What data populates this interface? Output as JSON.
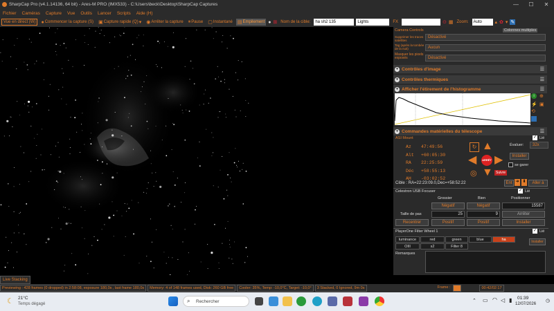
{
  "titlebar": {
    "title": "SharpCap Pro (v4.1.14136, 64 bit) - Ares-M PRO (IMX533) - C:\\Users\\beck\\Desktop\\SharpCap Captures",
    "min": "—",
    "max": "☐",
    "close": "✕"
  },
  "menu": [
    "Fichier",
    "Caméras",
    "Capture",
    "Vue",
    "Outils",
    "Lancer",
    "Scripts",
    "Aide (H)"
  ],
  "toolbar": {
    "live": "Vue en direct (W)",
    "start_capture": "Commencer la capture (S)",
    "quick_capture": "Capture rapide (Q)",
    "stop_capture": "Arrêter la capture",
    "pause": "Pause",
    "snapshot": "Instantané",
    "stacking": "Empilement",
    "target_label": "Nom de la cible:",
    "target_value": "ha sh2 135",
    "frame_type": "Lights",
    "fx_label": "FX",
    "zoom_label": "Zoom:",
    "zoom_value": "Auto"
  },
  "panel": {
    "camera_controls": "Camera Controls",
    "columns": "Colonnes multiples",
    "sat_trails_label": "Supprimer les traces satellites",
    "sat_trails_value": "Désactivé",
    "tag_label": "Tag (après la tombée de la nuit)",
    "tag_value": "Aucun",
    "hot_pixels_label": "Masquer les pixels exposés",
    "hot_pixels_value": "Désactivé",
    "image_controls": "Contrôles d'image",
    "thermal_controls": "Contrôles thermiques",
    "histogram": "Afficher l'étirement de l'histogramme",
    "telescope": "Commandes matérielles du télescope",
    "mount_name": "ASI Mount",
    "link": "Lié",
    "az_label": "Az",
    "az": "47:49:56",
    "alt_label": "Alt",
    "alt": "+60:05:30",
    "ra_label": "RA",
    "ra": "22:25:59",
    "dec_label": "Déc",
    "dec": "+58:55:13",
    "ah_label": "AH",
    "ah": "-03:02:52",
    "eval_label": "Évaluer:",
    "eval_value": "32x",
    "install": "Installer",
    "park": "se garer",
    "follow": "Suivre",
    "stop": "ARRÊT",
    "target_line": "Cible : RA=22:23:09.0,Dec=+58:52:22",
    "ent": "Ent",
    "goto": "Aller à",
    "focuser_name": "Celestron USB Focuser",
    "coarse": "Grossier",
    "fine": "Bien",
    "position": "Positionner",
    "negative": "Négatif",
    "positive": "Positif",
    "position_value": "15587",
    "step_label": "Taille de pas",
    "step_value": "25",
    "fine_step": "9",
    "stop_btn": "Arrêter",
    "recenter": "Recentrer",
    "install2": "Installer",
    "wheel_name": "PlayerOne Filter Wheel 1",
    "filters": [
      "luminance",
      "red",
      "green",
      "blue",
      "ha",
      "OIII",
      "s2",
      "Filter 8"
    ],
    "wheel_install": "Installer",
    "remarks": "Remarques"
  },
  "livestack": "Live Stacking",
  "status": {
    "preview": "Previewing : 428 frames (0 dropped) in 2:58:08, exposure 180,0s , last frame 180,0s",
    "memory": "Memory: 4 of 148 frames used, Disk: 260 GB free",
    "cooler": "Cooler: 35%, Temp: -10,0°C, Target: -10,0°",
    "stacked": "3 Stacked, 0 Ignored, 9m 0s",
    "frame_label": "Frame :",
    "elapsed": "00:42/02:17"
  },
  "taskbar": {
    "temp": "21°C",
    "weather": "Temps dégagé",
    "search": "Rechercher",
    "time": "01:39",
    "date": "12/07/2026"
  },
  "colors": {
    "accent": "#e07b2a",
    "panel": "#2a2a2a",
    "red": "#d22"
  }
}
